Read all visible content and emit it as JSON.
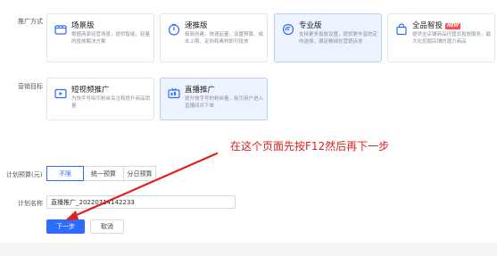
{
  "labels": {
    "promo_method": "推广方式",
    "marketing_goal": "营销目标",
    "budget": "计划预算(元)",
    "plan_name": "计划名称"
  },
  "promo_cards": [
    {
      "title": "场景版",
      "desc": "根据商家经营场景，提供智能、轻量的投放解决方案",
      "icon": "scene-icon"
    },
    {
      "title": "速推版",
      "desc": "极简创建，快速起量，设置预算、成本上限、定向和素材即可投放",
      "icon": "fast-icon"
    },
    {
      "title": "专业版",
      "desc": "支持更多投放设置，提供更丰富的定向选择，满足精细化营销诉求",
      "icon": "pro-icon"
    },
    {
      "title": "全品智投",
      "badge": "NEW",
      "desc": "提供全店铺商品托管式投放服务，最大化挖掘店铺的潜力商品",
      "icon": "bag-icon"
    }
  ],
  "goal_cards": [
    {
      "title": "短视频推广",
      "desc": "为快手号吸引粉丝关注和提升商品销量",
      "icon": "video-icon"
    },
    {
      "title": "直播推广",
      "desc": "提升快手号的粉丝量，吸引用户进入直播间并下单",
      "icon": "live-icon"
    }
  ],
  "budget_options": [
    "不限",
    "统一预算",
    "分日预算"
  ],
  "plan_name_value": "直播推广_20220714142233",
  "buttons": {
    "next": "下一步",
    "cancel": "取消"
  },
  "annotation": "在这个页面先按F12然后再下一步",
  "colors": {
    "primary": "#2f6bff",
    "annotation": "#e02020",
    "badge": "#ff4d4f"
  }
}
